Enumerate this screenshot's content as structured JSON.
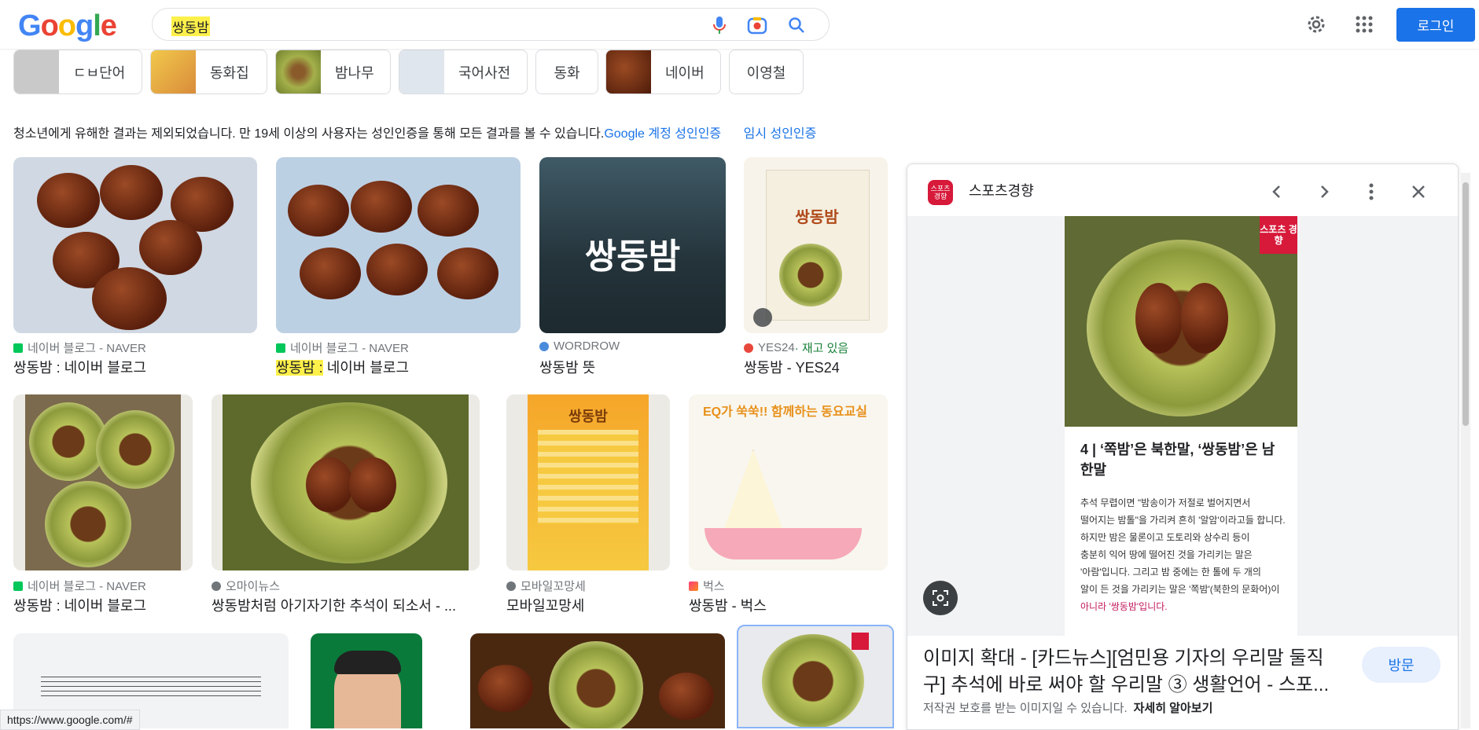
{
  "header": {
    "logo": "Google",
    "search_query": "쌍동밤",
    "login_label": "로그인",
    "icons": [
      "mic-icon",
      "camera-icon",
      "search-icon",
      "gear-icon",
      "apps-grid-icon"
    ]
  },
  "chips": [
    {
      "label": "ㄷㅂ단어"
    },
    {
      "label": "동화집"
    },
    {
      "label": "밤나무"
    },
    {
      "label": "국어사전"
    },
    {
      "label": "동화"
    },
    {
      "label": "네이버"
    },
    {
      "label": "이영철"
    }
  ],
  "notice": {
    "text": "청소년에게 유해한 결과는 제외되었습니다. 만 19세 이상의 사용자는 성인인증을 통해 모든 결과를 볼 수 있습니다.",
    "link1": "Google 계정 성인인증",
    "link2": "임시 성인인증"
  },
  "results_row1": [
    {
      "source": "네이버 블로그 - NAVER",
      "title": "쌍동밤 : 네이버 블로그"
    },
    {
      "source": "네이버 블로그 - NAVER",
      "title_highlight": "쌍동밤 :",
      "title_rest": " 네이버 블로그"
    },
    {
      "source": "WORDROW",
      "title": "쌍동밤 뜻",
      "image_text": "쌍동밤"
    },
    {
      "source": "YES24",
      "source_extra": " · 재고 있음",
      "title": "쌍동밤 - YES24",
      "image_text": "쌍동밤"
    }
  ],
  "results_row2": [
    {
      "source": "네이버 블로그 - NAVER",
      "title": "쌍동밤 : 네이버 블로그"
    },
    {
      "source": "오마이뉴스",
      "title": "쌍동밤처럼 아기자기한 추석이 되소서 - ..."
    },
    {
      "source": "모바일꼬망세",
      "title": "모바일꼬망세",
      "image_text": "쌍동밤"
    },
    {
      "source": "벅스",
      "title": "쌍동밤 - 벅스",
      "image_text": "EQ가 쑥쑥!! 함께하는 동요교실"
    }
  ],
  "panel": {
    "source": "스포츠경향",
    "logo_text": "스포츠 경향",
    "image_heading": "4 | ‘쪽밤’은 북한말, ‘쌍동밤’은 남한말",
    "image_body": [
      "추석 무렵이면 \"밤송이가 저절로 벌어지면서",
      "떨어지는 밤톨\"을 가리켜 흔히 '알암'이라고들 합니다.",
      "하지만 밤은 물론이고 도토리와 상수리 등이",
      "충분히 익어 땅에 떨어진 것을 가리키는 말은",
      "'아람'입니다. 그리고 밤 중에는 한 톨에 두 개의",
      "알이 든 것을 가리키는 말은 '쪽밤'(북한의 문화어)이",
      "아니라 '쌍동밤'입니다."
    ],
    "caption": "이미지 확대 - [카드뉴스][엄민용 기자의 우리말 둘직구] 추석에 바로 써야 할 우리말 ③ 생활언어 - 스포...",
    "copyright": "저작권 보호를 받는 이미지일 수 있습니다.",
    "more_link": "자세히 알아보기",
    "visit_label": "방문"
  },
  "status_url": "https://www.google.com/#",
  "colors": {
    "accent": "#1a73e8",
    "highlight": "#fef04a",
    "panel_logo": "#d7193a"
  }
}
